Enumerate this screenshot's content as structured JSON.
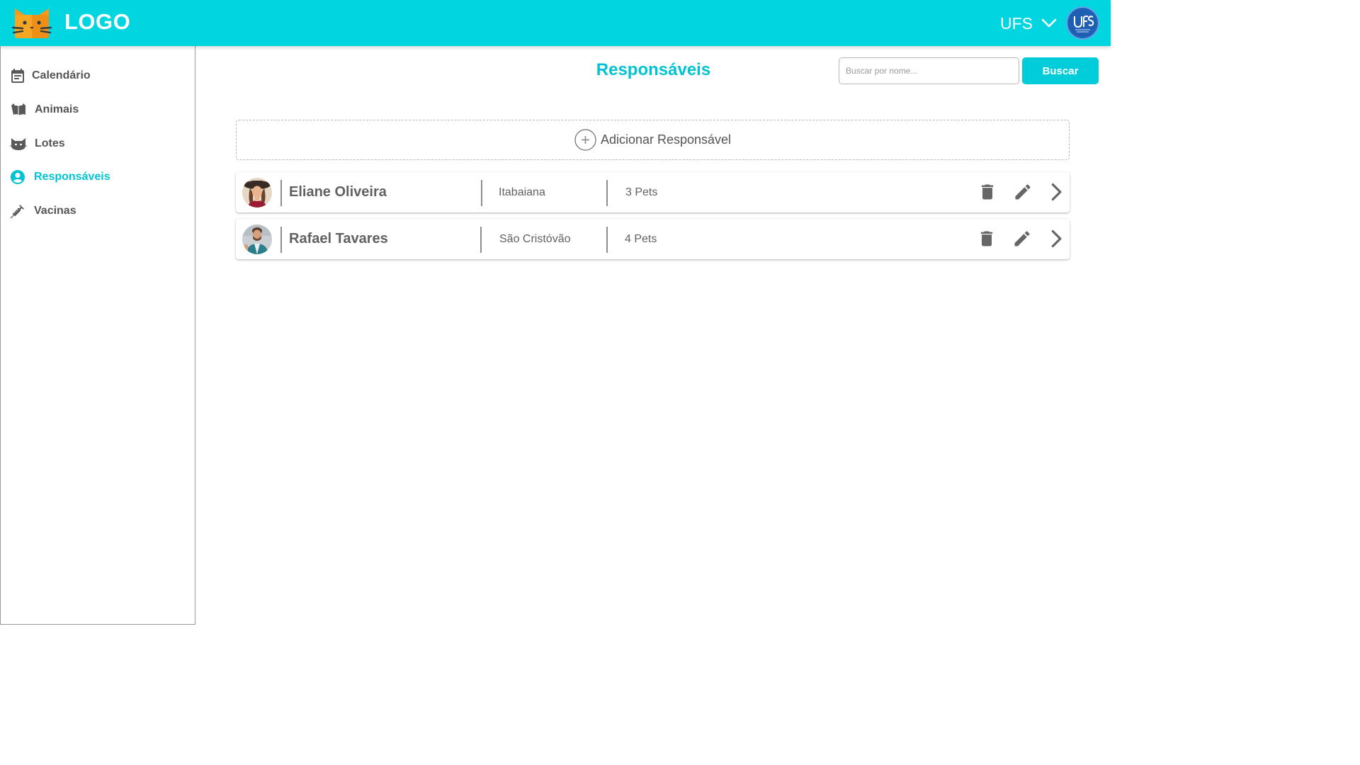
{
  "header": {
    "logo_text": "LOGO",
    "org_label": "UFS",
    "brand_color": "#00d5e0"
  },
  "sidebar": {
    "items": [
      {
        "label": "Calendário",
        "icon": "calendar-icon",
        "active": false
      },
      {
        "label": "Animais",
        "icon": "cat-book-icon",
        "active": false
      },
      {
        "label": "Lotes",
        "icon": "cat-face-icon",
        "active": false
      },
      {
        "label": "Responsáveis",
        "icon": "account-circle-icon",
        "active": true
      },
      {
        "label": "Vacinas",
        "icon": "syringe-icon",
        "active": false
      }
    ],
    "active_color": "#00c4d4"
  },
  "main": {
    "title": "Responsáveis",
    "search": {
      "placeholder": "Buscar por nome...",
      "value": ""
    },
    "search_button": "Buscar",
    "add_label": "Adicionar Responsável",
    "responsaveis": [
      {
        "name": "Eliane Oliveira",
        "city": "Itabaiana",
        "pets": "3 Pets"
      },
      {
        "name": "Rafael Tavares",
        "city": "São Cristóvão",
        "pets": "4 Pets"
      }
    ]
  }
}
